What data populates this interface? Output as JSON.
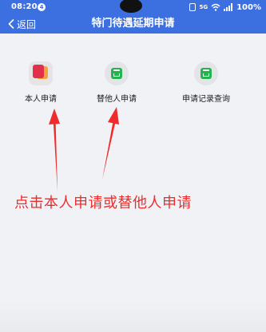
{
  "status_bar": {
    "time": "08:20",
    "badge": "4",
    "network": "5G",
    "battery": "100%",
    "icons": [
      "nfc-icon",
      "network-icon",
      "wifi-icon",
      "signal-icon",
      "battery-icon"
    ]
  },
  "header": {
    "back_label": "返回",
    "title": "特门待遇延期申请",
    "background": "#3c6fe0"
  },
  "menu": {
    "items": [
      {
        "label": "本人申请",
        "icon": "self-apply-icon"
      },
      {
        "label": "替他人申请",
        "icon": "apply-for-others-icon"
      },
      {
        "label": "申请记录查询",
        "icon": "records-query-icon"
      }
    ]
  },
  "annotation": {
    "text": "点击本人申请或替他人申请",
    "color": "#ef2b2b"
  }
}
